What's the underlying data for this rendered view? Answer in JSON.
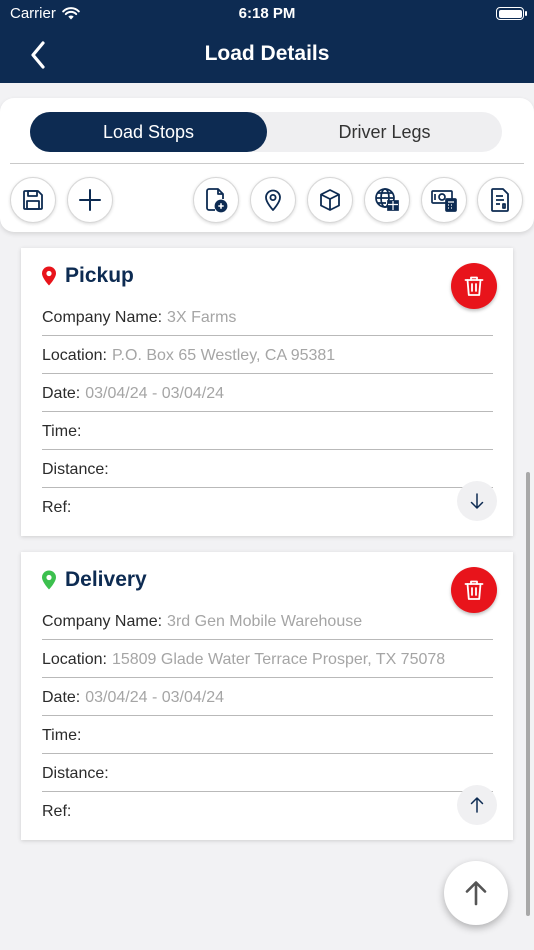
{
  "status_bar": {
    "carrier": "Carrier",
    "time": "6:18 PM"
  },
  "nav": {
    "title": "Load Details",
    "back_icon": "chevron-left-icon"
  },
  "tabs": [
    {
      "label": "Load Stops",
      "active": true
    },
    {
      "label": "Driver Legs",
      "active": false
    }
  ],
  "toolbar_icons": [
    "save-icon",
    "add-icon",
    "add-document-icon",
    "location-pin-icon",
    "package-box-icon",
    "globe-box-icon",
    "payment-calculator-icon",
    "document-list-icon"
  ],
  "stops": [
    {
      "type": "Pickup",
      "pin_color": "#e8141b",
      "fields": [
        {
          "key": "Company Name:",
          "value": "3X Farms"
        },
        {
          "key": "Location:",
          "value": "P.O. Box 65 Westley, CA 95381"
        },
        {
          "key": "Date:",
          "value": "03/04/24 - 03/04/24"
        },
        {
          "key": "Time:",
          "value": ""
        },
        {
          "key": "Distance:",
          "value": ""
        },
        {
          "key": "Ref:",
          "value": ""
        }
      ],
      "move_icon": "arrow-down-icon"
    },
    {
      "type": "Delivery",
      "pin_color": "#3cc04e",
      "fields": [
        {
          "key": "Company Name:",
          "value": "3rd Gen Mobile Warehouse"
        },
        {
          "key": "Location:",
          "value": "15809 Glade Water Terrace Prosper, TX 75078"
        },
        {
          "key": "Date:",
          "value": "03/04/24 - 03/04/24"
        },
        {
          "key": "Time:",
          "value": ""
        },
        {
          "key": "Distance:",
          "value": ""
        },
        {
          "key": "Ref:",
          "value": ""
        }
      ],
      "move_icon": "arrow-up-icon"
    }
  ],
  "colors": {
    "navy": "#0d2b52",
    "danger": "#e8141b"
  }
}
